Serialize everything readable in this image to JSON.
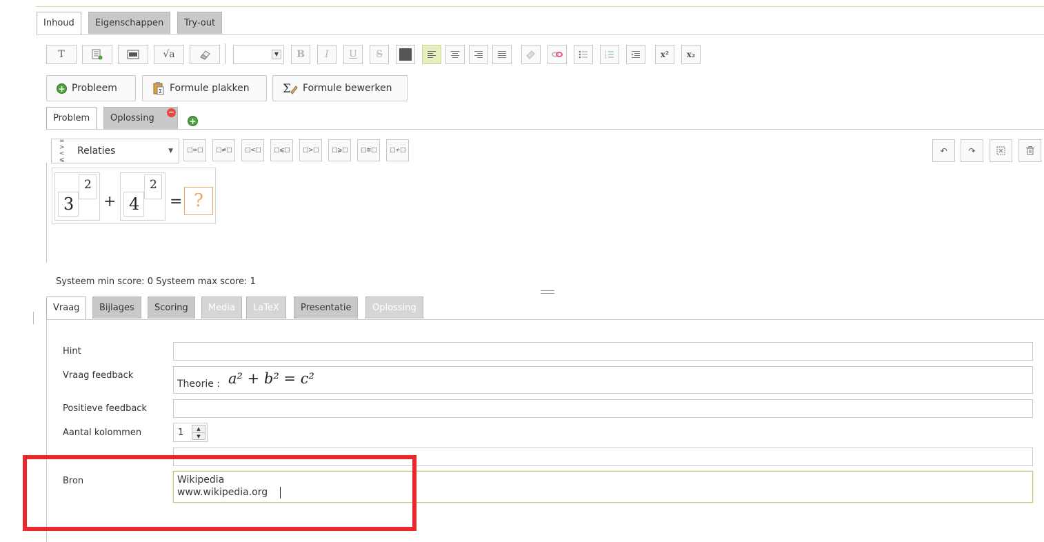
{
  "main_tabs": [
    {
      "label": "Inhoud",
      "active": true
    },
    {
      "label": "Eigenschappen",
      "active": false
    },
    {
      "label": "Try-out",
      "active": false
    }
  ],
  "toolbar": {
    "text_icon_glyph": "T",
    "sqrt_glyph": "√a",
    "bold": "B",
    "italic": "I",
    "underline": "U",
    "strike": "S",
    "superscript": "x²",
    "subscript": "x₂"
  },
  "actions": {
    "problem_label": "Probleem",
    "paste_label": "Formule plakken",
    "edit_label": "Formule bewerken"
  },
  "part_tabs": [
    {
      "label": "Problem",
      "active": true
    },
    {
      "label": "Oplossing",
      "active": false
    }
  ],
  "relations": {
    "selected": "Relaties",
    "icon_text": "= >\n< ⩽",
    "buttons": [
      "□=□",
      "□≠□",
      "□<□",
      "□⩽□",
      "□>□",
      "□⩾□",
      "□≅□",
      "□≁□"
    ]
  },
  "formula": {
    "base1": "3",
    "exp1": "2",
    "plus": "+",
    "base2": "4",
    "exp2": "2",
    "equals": "=",
    "answer": "?"
  },
  "score_text": "Systeem min score: 0  Systeem max score: 1",
  "lower_tabs": [
    {
      "label": "Vraag",
      "state": "active"
    },
    {
      "label": "Bijlages",
      "state": "normal"
    },
    {
      "label": "Scoring",
      "state": "normal"
    },
    {
      "label": "Media",
      "state": "dim"
    },
    {
      "label": "LaTeX",
      "state": "dim"
    },
    {
      "label": "Presentatie",
      "state": "normal"
    },
    {
      "label": "Oplossing",
      "state": "dim"
    }
  ],
  "form": {
    "hint_label": "Hint",
    "hint_value": "",
    "vraag_feedback_label": "Vraag feedback",
    "vraag_feedback_prefix": "Theorie :",
    "vraag_feedback_formula": "a² + b² = c²",
    "positieve_label": "Positieve feedback",
    "positieve_value": "",
    "kolommen_label": "Aantal kolommen",
    "kolommen_value": "1",
    "bron_label": "Bron",
    "bron_line1": "Wikipedia",
    "bron_line2": "www.wikipedia.org"
  },
  "colors": {
    "highlight_red": "#e8282d",
    "active_green": "#e6efc0",
    "placeholder_orange": "#f0a860"
  }
}
